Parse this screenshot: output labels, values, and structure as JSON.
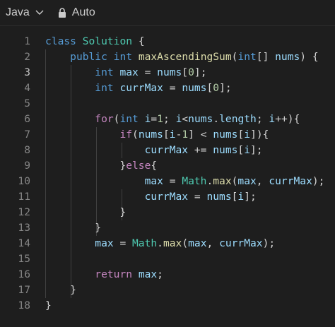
{
  "toolbar": {
    "language": "Java",
    "mode": "Auto"
  },
  "editor": {
    "active_line": 3,
    "lines": [
      {
        "num": "1",
        "tokens": [
          {
            "t": "class",
            "c": "kw"
          },
          {
            "t": " "
          },
          {
            "t": "Solution",
            "c": "cls"
          },
          {
            "t": " {"
          }
        ]
      },
      {
        "num": "2",
        "tokens": [
          {
            "t": "    "
          },
          {
            "t": "public",
            "c": "kw"
          },
          {
            "t": " "
          },
          {
            "t": "int",
            "c": "kw"
          },
          {
            "t": " "
          },
          {
            "t": "maxAscendingSum",
            "c": "fn"
          },
          {
            "t": "("
          },
          {
            "t": "int",
            "c": "kw"
          },
          {
            "t": "[] "
          },
          {
            "t": "nums",
            "c": "var"
          },
          {
            "t": ") {"
          }
        ]
      },
      {
        "num": "3",
        "tokens": [
          {
            "t": "        "
          },
          {
            "t": "int",
            "c": "kw"
          },
          {
            "t": " "
          },
          {
            "t": "max",
            "c": "var"
          },
          {
            "t": " = "
          },
          {
            "t": "nums",
            "c": "var"
          },
          {
            "t": "["
          },
          {
            "t": "0",
            "c": "num"
          },
          {
            "t": "];"
          }
        ]
      },
      {
        "num": "4",
        "tokens": [
          {
            "t": "        "
          },
          {
            "t": "int",
            "c": "kw"
          },
          {
            "t": " "
          },
          {
            "t": "currMax",
            "c": "var"
          },
          {
            "t": " = "
          },
          {
            "t": "nums",
            "c": "var"
          },
          {
            "t": "["
          },
          {
            "t": "0",
            "c": "num"
          },
          {
            "t": "];"
          }
        ]
      },
      {
        "num": "5",
        "tokens": []
      },
      {
        "num": "6",
        "tokens": [
          {
            "t": "        "
          },
          {
            "t": "for",
            "c": "ctl"
          },
          {
            "t": "("
          },
          {
            "t": "int",
            "c": "kw"
          },
          {
            "t": " "
          },
          {
            "t": "i",
            "c": "var"
          },
          {
            "t": "="
          },
          {
            "t": "1",
            "c": "num"
          },
          {
            "t": "; "
          },
          {
            "t": "i",
            "c": "var"
          },
          {
            "t": "<"
          },
          {
            "t": "nums",
            "c": "var"
          },
          {
            "t": "."
          },
          {
            "t": "length",
            "c": "var"
          },
          {
            "t": "; "
          },
          {
            "t": "i",
            "c": "var"
          },
          {
            "t": "++){"
          }
        ]
      },
      {
        "num": "7",
        "tokens": [
          {
            "t": "            "
          },
          {
            "t": "if",
            "c": "ctl"
          },
          {
            "t": "("
          },
          {
            "t": "nums",
            "c": "var"
          },
          {
            "t": "["
          },
          {
            "t": "i",
            "c": "var"
          },
          {
            "t": "-"
          },
          {
            "t": "1",
            "c": "num"
          },
          {
            "t": "] < "
          },
          {
            "t": "nums",
            "c": "var"
          },
          {
            "t": "["
          },
          {
            "t": "i",
            "c": "var"
          },
          {
            "t": "]){"
          }
        ]
      },
      {
        "num": "8",
        "tokens": [
          {
            "t": "                "
          },
          {
            "t": "currMax",
            "c": "var"
          },
          {
            "t": " += "
          },
          {
            "t": "nums",
            "c": "var"
          },
          {
            "t": "["
          },
          {
            "t": "i",
            "c": "var"
          },
          {
            "t": "];"
          }
        ]
      },
      {
        "num": "9",
        "tokens": [
          {
            "t": "            }"
          },
          {
            "t": "else",
            "c": "ctl"
          },
          {
            "t": "{"
          }
        ]
      },
      {
        "num": "10",
        "tokens": [
          {
            "t": "                "
          },
          {
            "t": "max",
            "c": "var"
          },
          {
            "t": " = "
          },
          {
            "t": "Math",
            "c": "cls"
          },
          {
            "t": "."
          },
          {
            "t": "max",
            "c": "fn"
          },
          {
            "t": "("
          },
          {
            "t": "max",
            "c": "var"
          },
          {
            "t": ", "
          },
          {
            "t": "currMax",
            "c": "var"
          },
          {
            "t": ");"
          }
        ]
      },
      {
        "num": "11",
        "tokens": [
          {
            "t": "                "
          },
          {
            "t": "currMax",
            "c": "var"
          },
          {
            "t": " = "
          },
          {
            "t": "nums",
            "c": "var"
          },
          {
            "t": "["
          },
          {
            "t": "i",
            "c": "var"
          },
          {
            "t": "];"
          }
        ]
      },
      {
        "num": "12",
        "tokens": [
          {
            "t": "            }"
          }
        ]
      },
      {
        "num": "13",
        "tokens": [
          {
            "t": "        }"
          }
        ]
      },
      {
        "num": "14",
        "tokens": [
          {
            "t": "        "
          },
          {
            "t": "max",
            "c": "var"
          },
          {
            "t": " = "
          },
          {
            "t": "Math",
            "c": "cls"
          },
          {
            "t": "."
          },
          {
            "t": "max",
            "c": "fn"
          },
          {
            "t": "("
          },
          {
            "t": "max",
            "c": "var"
          },
          {
            "t": ", "
          },
          {
            "t": "currMax",
            "c": "var"
          },
          {
            "t": ");"
          }
        ]
      },
      {
        "num": "15",
        "tokens": []
      },
      {
        "num": "16",
        "tokens": [
          {
            "t": "        "
          },
          {
            "t": "return",
            "c": "ctl"
          },
          {
            "t": " "
          },
          {
            "t": "max",
            "c": "var"
          },
          {
            "t": ";"
          }
        ]
      },
      {
        "num": "17",
        "tokens": [
          {
            "t": "    }"
          }
        ]
      },
      {
        "num": "18",
        "tokens": [
          {
            "t": "}"
          }
        ]
      }
    ]
  }
}
